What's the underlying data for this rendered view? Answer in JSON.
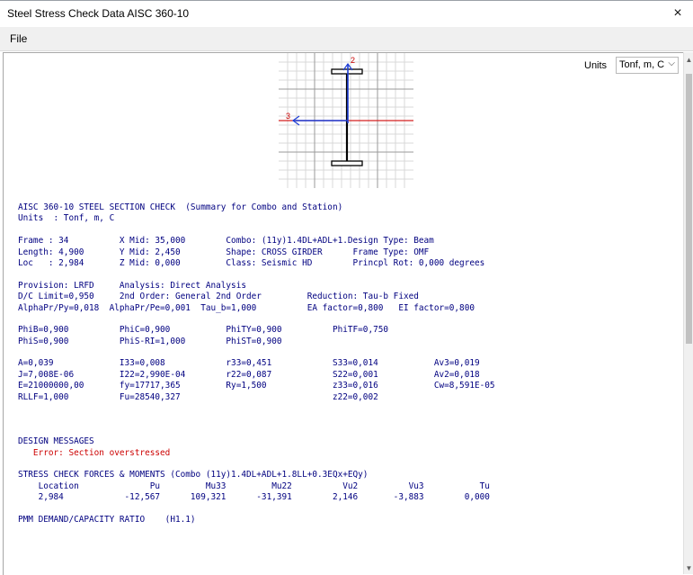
{
  "window": {
    "title": "Steel Stress Check Data  AISC 360-10",
    "close_glyph": "×"
  },
  "menu": {
    "file": "File"
  },
  "units": {
    "label": "Units",
    "value": "Tonf, m, C"
  },
  "diagram": {
    "axis_2_label": "2",
    "axis_3_label": "3"
  },
  "scroll": {
    "up_glyph": "▲",
    "down_glyph": "▼"
  },
  "report_lines": [
    {
      "text": "AISC 360-10 STEEL SECTION CHECK  (Summary for Combo and Station)"
    },
    {
      "text": "Units  : Tonf, m, C"
    },
    {
      "text": ""
    },
    {
      "text": "Frame : 34          X Mid: 35,000        Combo: (11y)1.4DL+ADL+1.Design Type: Beam"
    },
    {
      "text": "Length: 4,900       Y Mid: 2,450         Shape: CROSS GIRDER      Frame Type: OMF"
    },
    {
      "text": "Loc   : 2,984       Z Mid: 0,000         Class: Seismic HD        Princpl Rot: 0,000 degrees"
    },
    {
      "text": ""
    },
    {
      "text": "Provision: LRFD     Analysis: Direct Analysis"
    },
    {
      "text": "D/C Limit=0,950     2nd Order: General 2nd Order         Reduction: Tau-b Fixed"
    },
    {
      "text": "AlphaPr/Py=0,018  AlphaPr/Pe=0,001  Tau_b=1,000          EA factor=0,800   EI factor=0,800"
    },
    {
      "text": ""
    },
    {
      "text": "PhiB=0,900          PhiC=0,900           PhiTY=0,900          PhiTF=0,750"
    },
    {
      "text": "PhiS=0,900          PhiS-RI=1,000        PhiST=0,900"
    },
    {
      "text": ""
    },
    {
      "text": "A=0,039             I33=0,008            r33=0,451            S33=0,014           Av3=0,019"
    },
    {
      "text": "J=7,008E-06         I22=2,990E-04        r22=0,087            S22=0,001           Av2=0,018"
    },
    {
      "text": "E=21000000,00       fy=17717,365         Ry=1,500             z33=0,016           Cw=8,591E-05"
    },
    {
      "text": "RLLF=1,000          Fu=28540,327                              z22=0,002"
    },
    {
      "text": ""
    },
    {
      "text": ""
    },
    {
      "text": ""
    },
    {
      "text": "DESIGN MESSAGES"
    },
    {
      "text": "   Error: Section overstressed",
      "error": true
    },
    {
      "text": ""
    },
    {
      "text": "STRESS CHECK FORCES & MOMENTS (Combo (11y)1.4DL+ADL+1.8LL+0.3EQx+EQy)"
    },
    {
      "text": "    Location              Pu         Mu33         Mu22          Vu2          Vu3           Tu"
    },
    {
      "text": "    2,984            -12,567      109,321      -31,391        2,146       -3,883        0,000"
    },
    {
      "text": ""
    },
    {
      "text": "PMM DEMAND/CAPACITY RATIO    (H1.1)"
    }
  ],
  "colors": {
    "report_text": "#000080",
    "error_text": "#cc0000",
    "axis_3": "#d42020",
    "axis_2": "#1f3fd6"
  }
}
